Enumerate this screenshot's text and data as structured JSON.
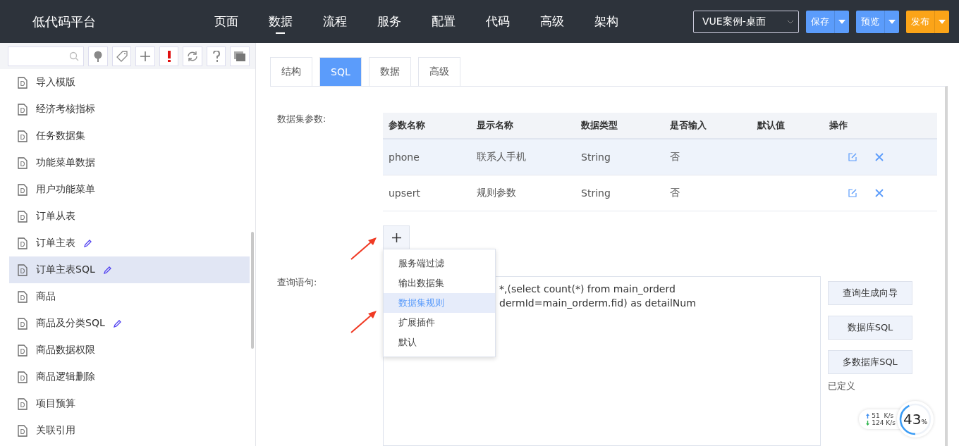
{
  "header": {
    "logo": "低代码平台",
    "nav": [
      {
        "label": "页面",
        "selected": false
      },
      {
        "label": "数据",
        "selected": true
      },
      {
        "label": "流程",
        "selected": false
      },
      {
        "label": "服务",
        "selected": false
      },
      {
        "label": "配置",
        "selected": false
      },
      {
        "label": "代码",
        "selected": false
      },
      {
        "label": "高级",
        "selected": false
      },
      {
        "label": "架构",
        "selected": false
      }
    ],
    "project_select": "VUE案例-桌面",
    "actions": [
      {
        "label": "保存",
        "color": "#5b9cfb"
      },
      {
        "label": "预览",
        "color": "#5b9cfb"
      },
      {
        "label": "发布",
        "color": "#fba418"
      }
    ]
  },
  "sidebar": {
    "tools": [
      {
        "kind": "tree"
      },
      {
        "kind": "tag"
      },
      {
        "kind": "plus"
      },
      {
        "kind": "alert"
      },
      {
        "kind": "refresh"
      },
      {
        "kind": "help"
      },
      {
        "kind": "windows"
      }
    ],
    "items": [
      {
        "label": "导入模版",
        "icon_letter": "D",
        "edited": false,
        "selected": false
      },
      {
        "label": "经济考核指标",
        "icon_letter": "D",
        "edited": false,
        "selected": false
      },
      {
        "label": "任务数据集",
        "icon_letter": "D",
        "edited": false,
        "selected": false
      },
      {
        "label": "功能菜单数据",
        "icon_letter": "D",
        "edited": false,
        "selected": false
      },
      {
        "label": "用户功能菜单",
        "icon_letter": "D",
        "edited": false,
        "selected": false
      },
      {
        "label": "订单从表",
        "icon_letter": "D",
        "edited": false,
        "selected": false
      },
      {
        "label": "订单主表",
        "icon_letter": "D",
        "edited": true,
        "selected": false
      },
      {
        "label": "订单主表SQL",
        "icon_letter": "D",
        "edited": true,
        "selected": true
      },
      {
        "label": "商品",
        "icon_letter": "D",
        "edited": false,
        "selected": false
      },
      {
        "label": "商品及分类SQL",
        "icon_letter": "D",
        "edited": true,
        "selected": false
      },
      {
        "label": "商品数据权限",
        "icon_letter": "D",
        "edited": false,
        "selected": false
      },
      {
        "label": "商品逻辑删除",
        "icon_letter": "D",
        "edited": false,
        "selected": false
      },
      {
        "label": "项目预算",
        "icon_letter": "D",
        "edited": false,
        "selected": false
      },
      {
        "label": "关联引用",
        "icon_letter": "D",
        "edited": false,
        "selected": false
      }
    ]
  },
  "tabs": [
    {
      "label": "结构",
      "selected": false
    },
    {
      "label": "SQL",
      "selected": true
    },
    {
      "label": "数据",
      "selected": false
    },
    {
      "label": "高级",
      "selected": false
    }
  ],
  "params": {
    "label": "数据集参数:",
    "columns": [
      "参数名称",
      "显示名称",
      "数据类型",
      "是否输入",
      "默认值",
      "操作"
    ],
    "rows": [
      {
        "cells": [
          "phone",
          "联系人手机",
          "String",
          "否"
        ],
        "selected": true
      },
      {
        "cells": [
          "upsert",
          "规则参数",
          "String",
          "否"
        ],
        "selected": false
      }
    ]
  },
  "add_menu": {
    "items": [
      {
        "label": "服务端过滤",
        "selected": false
      },
      {
        "label": "输出数据集",
        "selected": false
      },
      {
        "label": "数据集规则",
        "selected": true
      },
      {
        "label": "扩展插件",
        "selected": false
      },
      {
        "label": "默认",
        "selected": false
      }
    ]
  },
  "query": {
    "label": "查询语句:",
    "lines": [
      "*,(select count(*) from main_orderd",
      "dermId=main_orderm.fid) as detailNum"
    ],
    "buttons": [
      "查询生成向导",
      "数据库SQL",
      "多数据库SQL"
    ],
    "note": "已定义"
  },
  "net_widget": {
    "up": "51  K/s",
    "down": "124 K/s",
    "percent": "43",
    "unit": "%"
  }
}
